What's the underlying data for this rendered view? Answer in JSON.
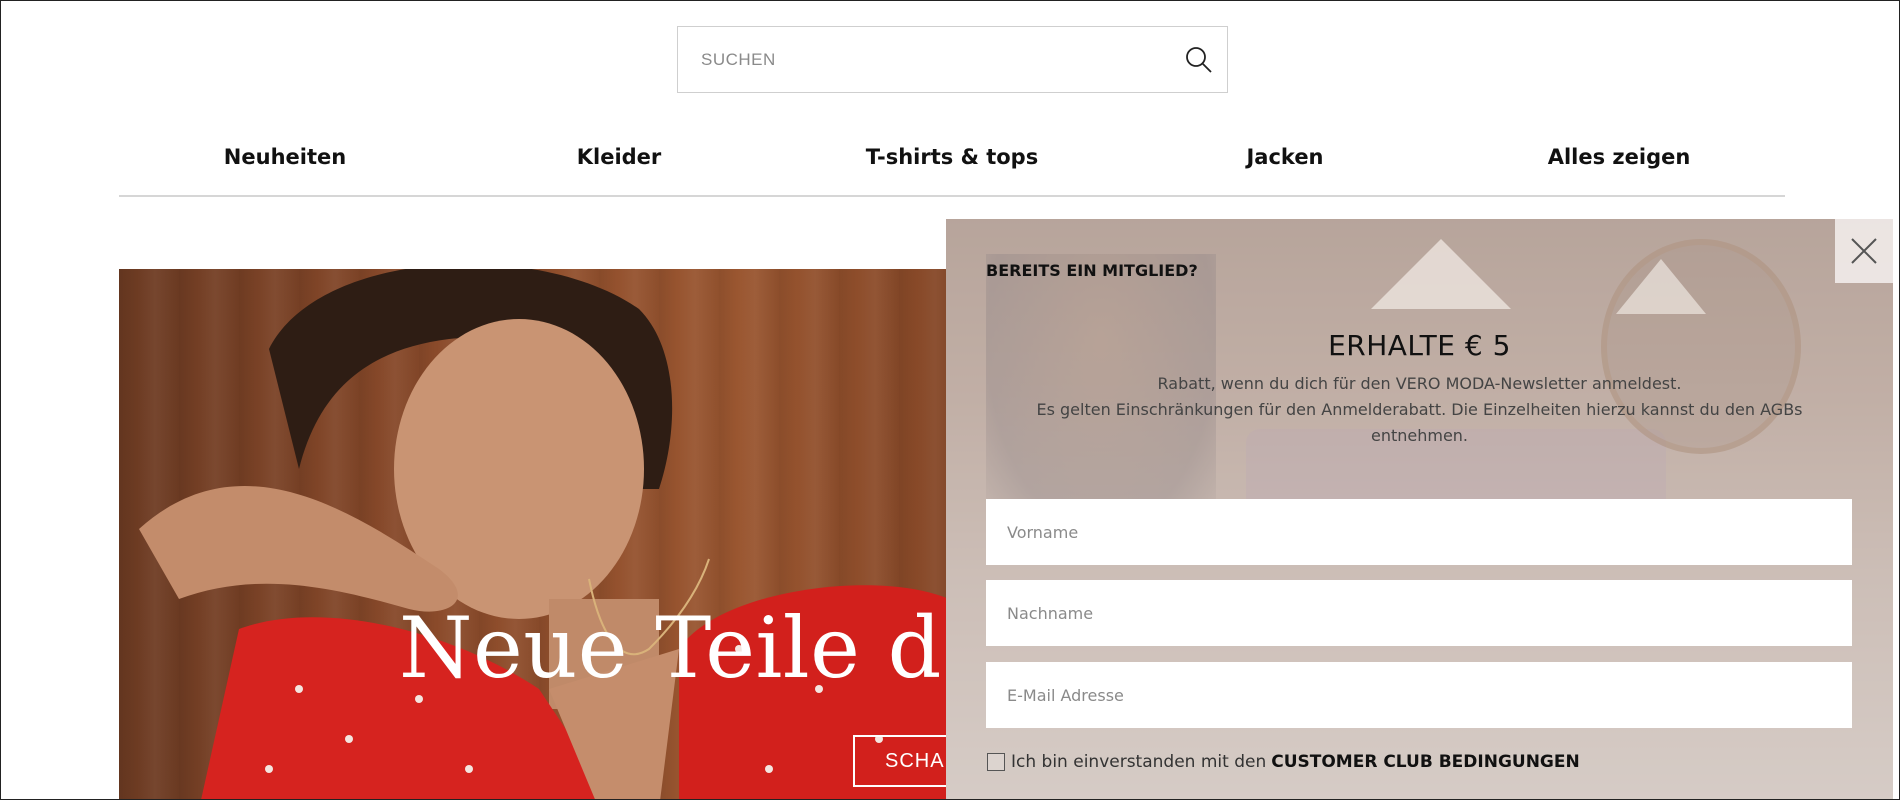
{
  "search": {
    "placeholder": "SUCHEN",
    "icon": "search-icon"
  },
  "nav": {
    "items": [
      {
        "label": "Neuheiten"
      },
      {
        "label": "Kleider"
      },
      {
        "label": "T-shirts & tops"
      },
      {
        "label": "Jacken"
      },
      {
        "label": "Alles zeigen"
      }
    ]
  },
  "hero": {
    "headline": "Neue Teile der",
    "button_label": "SCHA"
  },
  "modal": {
    "member_link": "BEREITS EIN MITGLIED?",
    "headline": "ERHALTE € 5",
    "subtext_line1": "Rabatt, wenn du dich für den VERO MODA-Newsletter anmeldest.",
    "subtext_line2": "Es gelten Einschränkungen für den Anmelderabatt. Die Einzelheiten hierzu kannst du den AGBs entnehmen.",
    "fields": {
      "firstname_placeholder": "Vorname",
      "lastname_placeholder": "Nachname",
      "email_placeholder": "E-Mail Adresse"
    },
    "consent_text": "Ich bin einverstanden mit den",
    "consent_link": "CUSTOMER CLUB BEDINGUNGEN",
    "close_icon": "close-icon"
  },
  "colors": {
    "text": "#111111",
    "nav_divider": "#d6d6d6",
    "search_border": "#cfcfcf",
    "modal_tint": "#dcd2cd"
  }
}
